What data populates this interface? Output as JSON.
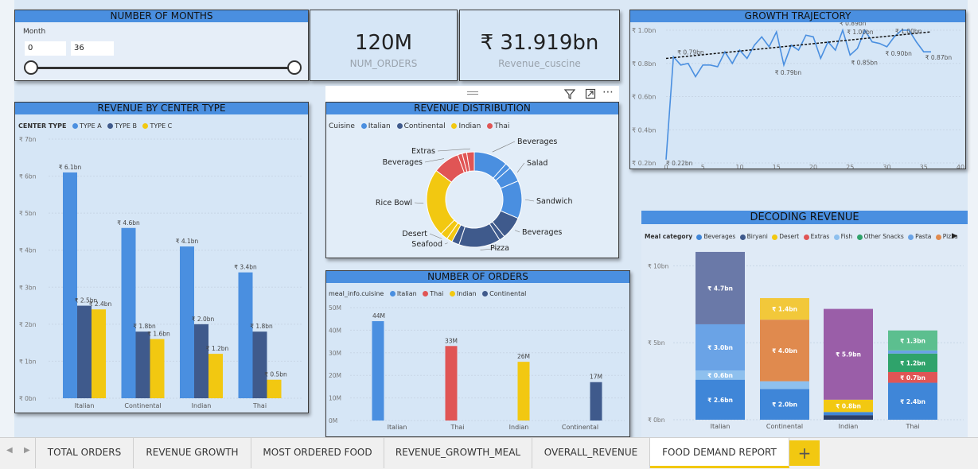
{
  "slicer": {
    "title": "NUMBER OF MONTHS",
    "field_label": "Month",
    "min_value": "0",
    "max_value": "36"
  },
  "kpi_orders": {
    "value": "120M",
    "label": "NUM_ORDERS"
  },
  "kpi_revenue": {
    "value": "₹ 31.919bn",
    "label": "Revenue_cuscine"
  },
  "growth": {
    "title": "GROWTH TRAJECTORY",
    "y_ticks": [
      "₹ 1.0bn",
      "₹ 0.8bn",
      "₹ 0.6bn",
      "₹ 0.4bn",
      "₹ 0.2bn"
    ],
    "x_ticks": [
      "0",
      "5",
      "10",
      "15",
      "20",
      "25",
      "30",
      "35",
      "40"
    ],
    "labels": [
      "₹ 0.22bn",
      "₹ 0.79bn",
      "₹ 0.79bn",
      "₹ 0.89bn",
      "₹ 1.00bn",
      "₹ 0.85bn",
      "₹ 0.90bn",
      "₹ 1.00bn",
      "₹ 0.87bn"
    ]
  },
  "center_type": {
    "title": "REVENUE BY CENTER TYPE",
    "legend_title": "CENTER TYPE",
    "legend": [
      "TYPE A",
      "TYPE B",
      "TYPE C"
    ],
    "y_ticks": [
      "₹ 7bn",
      "₹ 6bn",
      "₹ 5bn",
      "₹ 4bn",
      "₹ 3bn",
      "₹ 2bn",
      "₹ 1bn",
      "₹ 0bn"
    ],
    "categories": [
      "Italian",
      "Continental",
      "Indian",
      "Thai"
    ],
    "labels": [
      [
        "₹ 6.1bn",
        "₹ 2.5bn",
        "₹ 2.4bn"
      ],
      [
        "₹ 4.6bn",
        "₹ 1.8bn",
        "₹ 1.6bn"
      ],
      [
        "₹ 4.1bn",
        "₹ 2.0bn",
        "₹ 1.2bn"
      ],
      [
        "₹ 3.4bn",
        "₹ 1.8bn",
        "₹ 0.5bn"
      ]
    ]
  },
  "distribution": {
    "title": "REVENUE DISTRIBUTION",
    "legend_title": "Cuisine",
    "legend": [
      "Italian",
      "Continental",
      "Indian",
      "Thai"
    ],
    "slice_labels": [
      "Beverages",
      "Salad",
      "Sandwich",
      "Beverages",
      "Pizza",
      "Seafood",
      "Desert",
      "Rice Bowl",
      "Beverages",
      "Extras"
    ]
  },
  "orders": {
    "title": "NUMBER OF ORDERS",
    "legend_title": "meal_info.cuisine",
    "legend": [
      "Italian",
      "Thai",
      "Indian",
      "Continental"
    ],
    "y_ticks": [
      "50M",
      "40M",
      "30M",
      "20M",
      "10M",
      "0M"
    ],
    "categories": [
      "Italian",
      "Thai",
      "Indian",
      "Continental"
    ],
    "labels": [
      "44M",
      "33M",
      "26M",
      "17M"
    ]
  },
  "decoding": {
    "title": "DECODING REVENUE",
    "legend_title": "Meal category",
    "legend": [
      "Beverages",
      "Biryani",
      "Desert",
      "Extras",
      "Fish",
      "Other Snacks",
      "Pasta",
      "Pizza"
    ],
    "y_ticks": [
      "₹ 10bn",
      "₹ 5bn",
      "₹ 0bn"
    ],
    "categories": [
      "Italian",
      "Continental",
      "Indian",
      "Thai"
    ],
    "segment_labels": {
      "italian": [
        "₹ 2.6bn",
        "₹ 0.6bn",
        "₹ 3.0bn",
        "₹ 4.7bn"
      ],
      "continental": [
        "₹ 2.0bn",
        "₹ 4.0bn",
        "₹ 1.4bn"
      ],
      "indian": [
        "₹ 0.8bn",
        "₹ 5.9bn"
      ],
      "thai": [
        "₹ 2.4bn",
        "₹ 0.7bn",
        "₹ 1.2bn",
        "₹ 1.3bn"
      ]
    }
  },
  "colors": {
    "type_a": "#4a8fe0",
    "type_b": "#3f5a8c",
    "type_c": "#f2c811",
    "italian": "#4a8fe0",
    "continental": "#3f5a8c",
    "indian": "#f2c811",
    "thai": "#e05555",
    "header": "#4a8fe0"
  },
  "tabs": [
    "TOTAL ORDERS",
    "REVENUE GROWTH",
    "MOST ORDERED FOOD",
    "REVENUE_GROWTH_MEAL",
    "OVERALL_REVENUE",
    "FOOD DEMAND REPORT"
  ],
  "active_tab": "FOOD DEMAND REPORT",
  "add_tab_symbol": "+",
  "chart_data": [
    {
      "type": "line",
      "title": "GROWTH TRAJECTORY",
      "x": [
        0,
        1,
        2,
        3,
        4,
        5,
        6,
        7,
        8,
        9,
        10,
        11,
        12,
        13,
        14,
        15,
        16,
        17,
        18,
        19,
        20,
        21,
        22,
        23,
        24,
        25,
        26,
        27,
        28,
        29,
        30,
        31,
        32,
        33,
        34,
        35,
        36
      ],
      "series": [
        {
          "values": [
            0.22,
            0.84,
            0.79,
            0.8,
            0.72,
            0.79,
            0.79,
            0.78,
            0.87,
            0.8,
            0.88,
            0.83,
            0.91,
            0.96,
            0.9,
            0.99,
            0.79,
            0.91,
            0.88,
            0.97,
            0.96,
            0.83,
            0.93,
            0.88,
            1.0,
            0.85,
            0.89,
            1.0,
            0.93,
            0.92,
            0.9,
            0.96,
            1.0,
            1.0,
            0.93,
            0.87,
            0.87
          ]
        }
      ],
      "trend": [
        [
          0,
          0.83
        ],
        [
          36,
          0.99
        ]
      ],
      "ylim": [
        0.2,
        1.0
      ],
      "xlim": [
        0,
        40
      ]
    },
    {
      "type": "bar",
      "title": "REVENUE BY CENTER TYPE",
      "categories": [
        "Italian",
        "Continental",
        "Indian",
        "Thai"
      ],
      "series": [
        {
          "name": "TYPE A",
          "values": [
            6.1,
            4.6,
            4.1,
            3.4
          ]
        },
        {
          "name": "TYPE B",
          "values": [
            2.5,
            1.8,
            2.0,
            1.8
          ]
        },
        {
          "name": "TYPE C",
          "values": [
            2.4,
            1.6,
            1.2,
            0.5
          ]
        }
      ],
      "ylim": [
        0,
        7
      ]
    },
    {
      "type": "pie",
      "title": "REVENUE DISTRIBUTION",
      "slices": [
        {
          "label": "Beverages",
          "cuisine": "Italian",
          "value": 9
        },
        {
          "label": "",
          "cuisine": "Italian",
          "value": 1.5
        },
        {
          "label": "Salad",
          "cuisine": "Italian",
          "value": 4
        },
        {
          "label": "Sandwich",
          "cuisine": "Italian",
          "value": 10
        },
        {
          "label": "Beverages",
          "cuisine": "Continental",
          "value": 6
        },
        {
          "label": "",
          "cuisine": "Continental",
          "value": 1.5
        },
        {
          "label": "Pizza",
          "cuisine": "Continental",
          "value": 11
        },
        {
          "label": "",
          "cuisine": "Continental",
          "value": 2
        },
        {
          "label": "Seafood",
          "cuisine": "Indian",
          "value": 1.5
        },
        {
          "label": "Desert",
          "cuisine": "Indian",
          "value": 2
        },
        {
          "label": "Rice Bowl",
          "cuisine": "Indian",
          "value": 18
        },
        {
          "label": "Beverages",
          "cuisine": "Thai",
          "value": 7
        },
        {
          "label": "",
          "cuisine": "Thai",
          "value": 1.2
        },
        {
          "label": "",
          "cuisine": "Thai",
          "value": 1.2
        },
        {
          "label": "Extras",
          "cuisine": "Thai",
          "value": 2
        }
      ]
    },
    {
      "type": "bar",
      "title": "NUMBER OF ORDERS",
      "categories": [
        "Italian",
        "Thai",
        "Indian",
        "Continental"
      ],
      "values": [
        44,
        33,
        26,
        17
      ],
      "ylabel": "",
      "ylim": [
        0,
        50
      ]
    },
    {
      "type": "bar",
      "title": "DECODING REVENUE",
      "categories": [
        "Italian",
        "Continental",
        "Indian",
        "Thai"
      ],
      "stacked": true,
      "stacks": [
        [
          {
            "v": 2.6,
            "c": "#3f86d8",
            "l": "₹ 2.6bn"
          },
          {
            "v": 0.6,
            "c": "#8ec0ee",
            "l": "₹ 0.6bn"
          },
          {
            "v": 3.0,
            "c": "#6aa3e6",
            "l": "₹ 3.0bn"
          },
          {
            "v": 4.7,
            "c": "#6a79a8",
            "l": "₹ 4.7bn"
          }
        ],
        [
          {
            "v": 2.0,
            "c": "#3f86d8",
            "l": "₹ 2.0bn"
          },
          {
            "v": 0.5,
            "c": "#8ec0ee",
            "l": ""
          },
          {
            "v": 4.0,
            "c": "#e08a4e",
            "l": "₹ 4.0bn"
          },
          {
            "v": 1.4,
            "c": "#f2c83a",
            "l": "₹ 1.4bn"
          }
        ],
        [
          {
            "v": 0.3,
            "c": "#2a3f6a",
            "l": ""
          },
          {
            "v": 0.2,
            "c": "#3f86d8",
            "l": ""
          },
          {
            "v": 0.8,
            "c": "#f2c811",
            "l": "₹ 0.8bn"
          },
          {
            "v": 5.9,
            "c": "#9a5ea8",
            "l": "₹ 5.9bn"
          }
        ],
        [
          {
            "v": 2.4,
            "c": "#3f86d8",
            "l": "₹ 2.4bn"
          },
          {
            "v": 0.7,
            "c": "#e05555",
            "l": "₹ 0.7bn"
          },
          {
            "v": 1.2,
            "c": "#2fa36b",
            "l": "₹ 1.2bn"
          },
          {
            "v": 0.2,
            "c": "#6aa3e6",
            "l": ""
          },
          {
            "v": 1.3,
            "c": "#5cbf8f",
            "l": "₹ 1.3bn"
          }
        ]
      ],
      "ylim": [
        0,
        11
      ]
    }
  ]
}
